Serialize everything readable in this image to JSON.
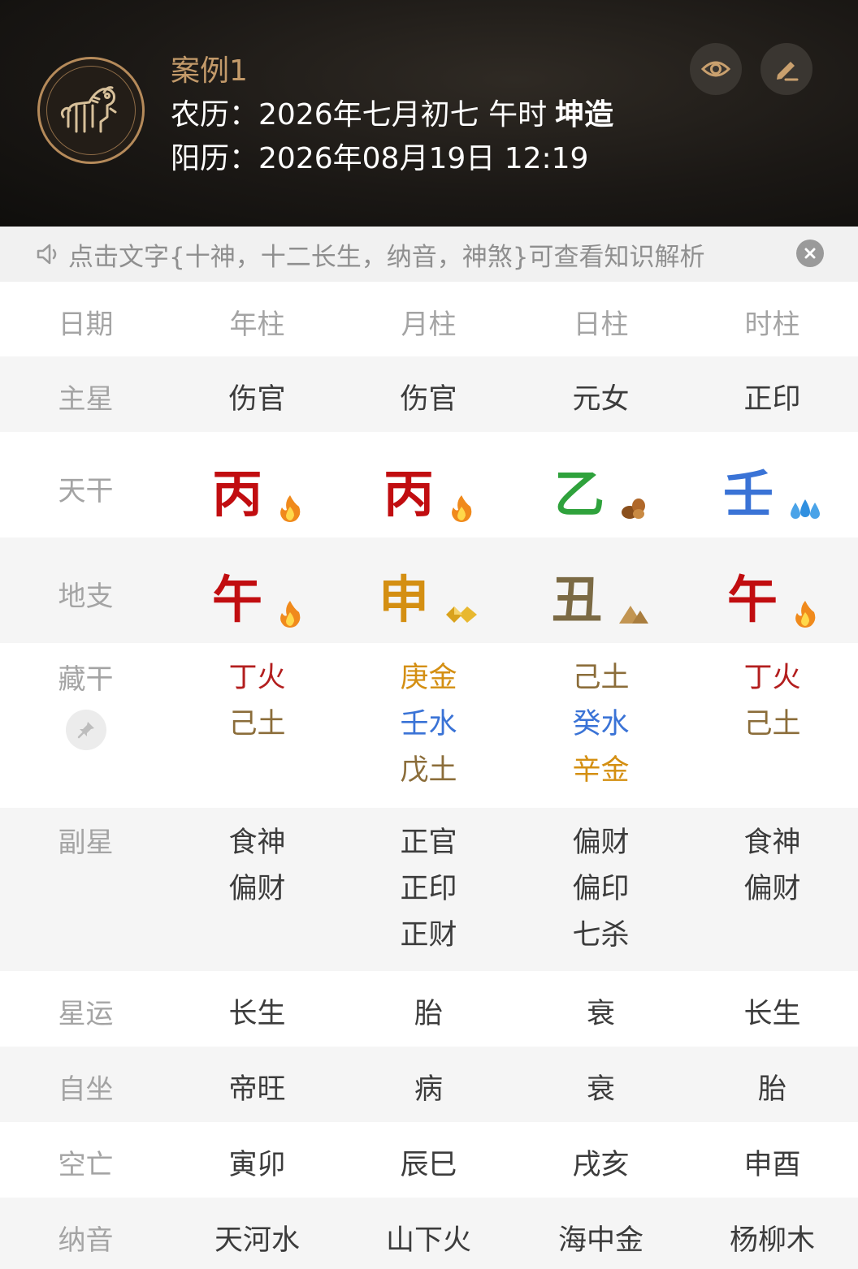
{
  "header": {
    "case_title": "案例1",
    "lunar_prefix": "农历：",
    "lunar_date": "2026年七月初七 午时",
    "gender": "坤造",
    "solar_prefix": "阳历：",
    "solar_date": "2026年08月19日 12:19",
    "avatar_icon": "horse-zodiac-icon",
    "eye_icon": "eye-icon",
    "edit_icon": "pencil-icon"
  },
  "notice": {
    "text": "点击文字{十神，十二长生，纳音，神煞}可查看知识解析",
    "speaker_icon": "speaker-icon",
    "close_icon": "close-icon"
  },
  "columns": [
    "日期",
    "年柱",
    "月柱",
    "日柱",
    "时柱"
  ],
  "rows": {
    "main_star": {
      "label": "主星",
      "values": [
        "伤官",
        "伤官",
        "元女",
        "正印"
      ]
    },
    "heavenly_stem": {
      "label": "天干",
      "values": [
        {
          "char": "丙",
          "color": "#c10d10",
          "icon": "fire-icon"
        },
        {
          "char": "丙",
          "color": "#c10d10",
          "icon": "fire-icon"
        },
        {
          "char": "乙",
          "color": "#2fa23c",
          "icon": "wood-icon"
        },
        {
          "char": "壬",
          "color": "#3a73d6",
          "icon": "water-icon"
        }
      ]
    },
    "earthly_branch": {
      "label": "地支",
      "values": [
        {
          "char": "午",
          "color": "#c10d10",
          "icon": "fire-icon"
        },
        {
          "char": "申",
          "color": "#d48f12",
          "icon": "metal-icon"
        },
        {
          "char": "丑",
          "color": "#7b6a44",
          "icon": "earth-icon"
        },
        {
          "char": "午",
          "color": "#c10d10",
          "icon": "fire-icon"
        }
      ]
    },
    "hidden_stems": {
      "label": "藏干",
      "pin_icon": "pin-icon",
      "values": [
        [
          {
            "text": "丁火",
            "color": "#b31e1e"
          },
          {
            "text": "己土",
            "color": "#8b6d3a"
          }
        ],
        [
          {
            "text": "庚金",
            "color": "#d48f12"
          },
          {
            "text": "壬水",
            "color": "#3a73d6"
          },
          {
            "text": "戊土",
            "color": "#8b6d3a"
          }
        ],
        [
          {
            "text": "己土",
            "color": "#8b6d3a"
          },
          {
            "text": "癸水",
            "color": "#3a73d6"
          },
          {
            "text": "辛金",
            "color": "#d48f12"
          }
        ],
        [
          {
            "text": "丁火",
            "color": "#b31e1e"
          },
          {
            "text": "己土",
            "color": "#8b6d3a"
          }
        ]
      ]
    },
    "sub_star": {
      "label": "副星",
      "values": [
        [
          "食神",
          "偏财"
        ],
        [
          "正官",
          "正印",
          "正财"
        ],
        [
          "偏财",
          "偏印",
          "七杀"
        ],
        [
          "食神",
          "偏财"
        ]
      ]
    },
    "star_luck": {
      "label": "星运",
      "values": [
        "长生",
        "胎",
        "衰",
        "长生"
      ]
    },
    "self_sit": {
      "label": "自坐",
      "values": [
        "帝旺",
        "病",
        "衰",
        "胎"
      ]
    },
    "void": {
      "label": "空亡",
      "values": [
        "寅卯",
        "辰巳",
        "戌亥",
        "申酉"
      ]
    },
    "nayin": {
      "label": "纳音",
      "values": [
        "天河水",
        "山下火",
        "海中金",
        "杨柳木"
      ]
    }
  }
}
